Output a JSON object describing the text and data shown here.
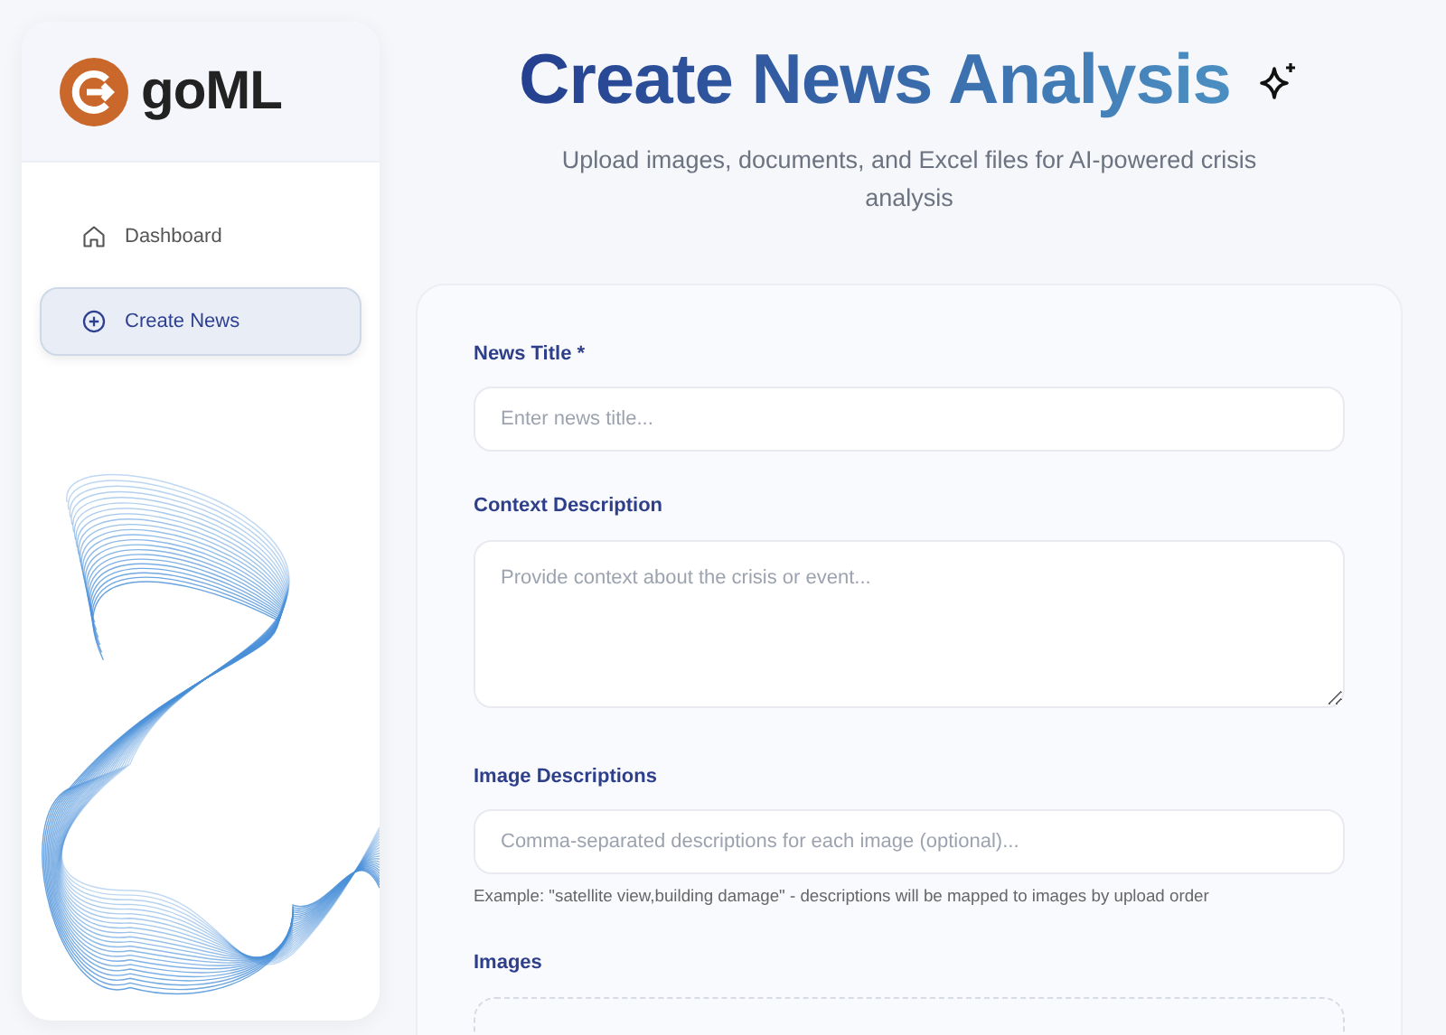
{
  "sidebar": {
    "logo_text": "goML",
    "items": [
      {
        "label": "Dashboard",
        "selected": false
      },
      {
        "label": "Create News",
        "selected": true
      }
    ]
  },
  "header": {
    "title": "Create News Analysis",
    "subtitle": "Upload images, documents, and Excel files for AI-powered crisis analysis"
  },
  "form": {
    "fields": [
      {
        "kind": "input",
        "label": "News Title *",
        "placeholder": "Enter news title..."
      },
      {
        "kind": "textarea",
        "label": "Context Description",
        "placeholder": "Provide context about the crisis or event..."
      },
      {
        "kind": "input",
        "label": "Image Descriptions",
        "placeholder": "Comma-separated descriptions for each image (optional)...",
        "hint": "Example: \"satellite view,building damage\" - descriptions will be mapped to images by upload order"
      },
      {
        "kind": "dropzone",
        "label": "Images"
      }
    ]
  }
}
